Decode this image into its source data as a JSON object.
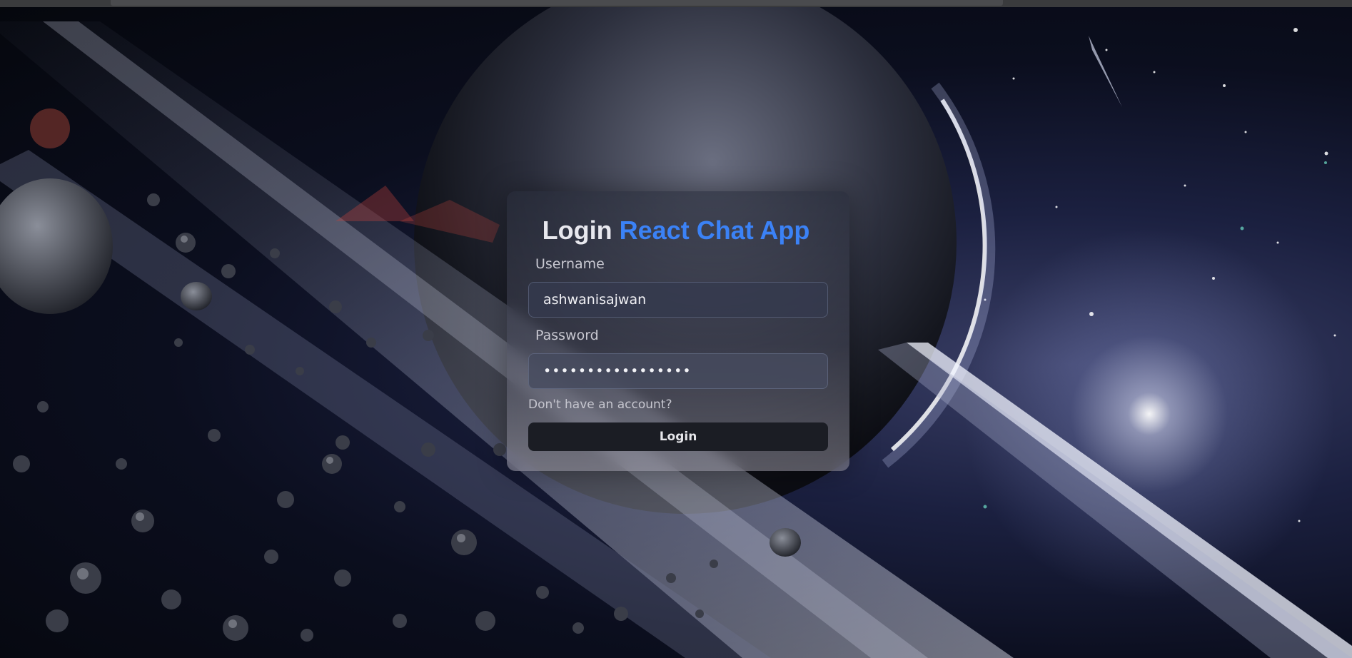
{
  "page": {
    "title_prefix": "Login",
    "title_accent": "React Chat App",
    "accent_color": "#3b82f6"
  },
  "form": {
    "username_label": "Username",
    "username_value": "ashwanisajwan",
    "password_label": "Password",
    "password_value": "•••••••••••••••••",
    "signup_prompt": "Don't have an account?",
    "submit_label": "Login"
  }
}
